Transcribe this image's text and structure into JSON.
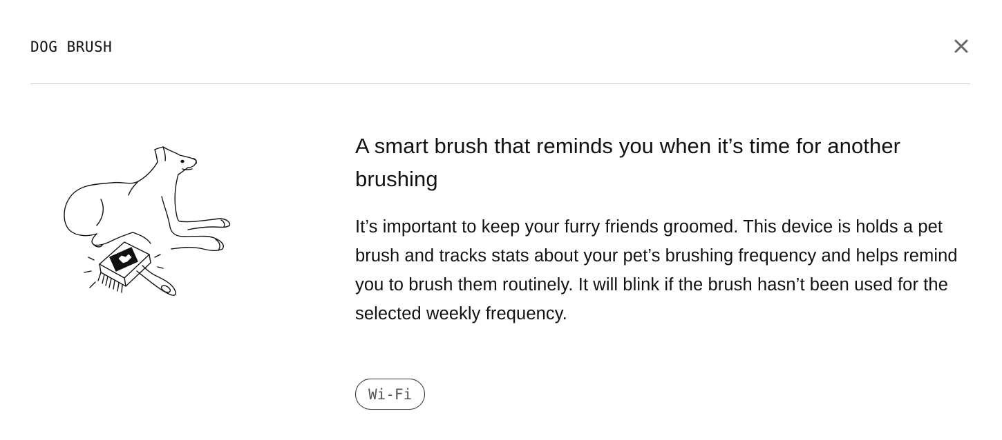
{
  "header": {
    "title": "DOG BRUSH",
    "close_icon": "close-icon"
  },
  "illustration": {
    "icon": "dog-with-brush-illustration"
  },
  "content": {
    "headline": "A smart brush that reminds you when it’s time for another brushing",
    "description": "It’s important to keep your furry friends groomed. This device is holds a pet brush and tracks stats about your pet’s brushing frequency and helps remind you to brush them routinely. It will blink if the brush hasn’t been used for the selected weekly frequency."
  },
  "tags": [
    {
      "label": "Wi-Fi"
    }
  ],
  "colors": {
    "text": "#111111",
    "divider": "#cfcfcf",
    "tag_text": "#555555",
    "close_icon": "#666666"
  }
}
